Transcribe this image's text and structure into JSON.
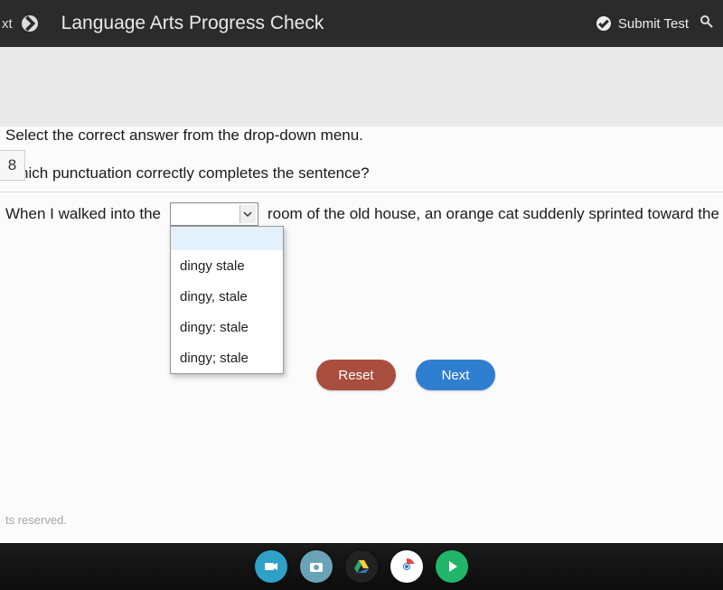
{
  "header": {
    "left_fragment": "xt",
    "title": "Language Arts Progress Check",
    "submit_label": "Submit Test"
  },
  "question": {
    "number": "8",
    "instruction": "Select the correct answer from the drop-down menu.",
    "prompt": "Which punctuation correctly completes the sentence?",
    "sentence_before": "When I walked into the",
    "sentence_after": "room of the old house, an orange cat suddenly sprinted toward the door.",
    "dropdown": {
      "selected": "",
      "options": [
        "",
        "dingy stale",
        "dingy, stale",
        "dingy: stale",
        "dingy; stale"
      ]
    },
    "buttons": {
      "reset": "Reset",
      "next": "Next"
    }
  },
  "footer": {
    "rights": "ts reserved."
  },
  "colors": {
    "reset_btn": "#a94d3f",
    "next_btn": "#2f7fd1",
    "topbar": "#2b2b2b"
  }
}
